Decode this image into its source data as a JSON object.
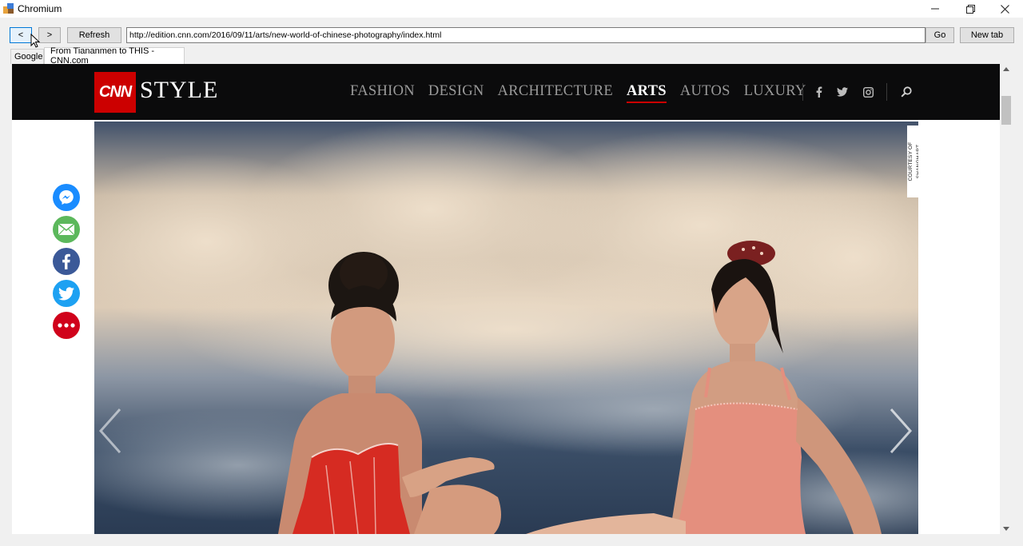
{
  "window": {
    "title": "Chromium",
    "controls": {
      "minimize": "—",
      "maximize": "❐",
      "close": "✕"
    }
  },
  "toolbar": {
    "back_label": "<",
    "forward_label": ">",
    "refresh_label": "Refresh",
    "url": "http://edition.cnn.com/2016/09/11/arts/new-world-of-chinese-photography/index.html",
    "go_label": "Go",
    "new_tab_label": "New tab"
  },
  "tabs": [
    {
      "label": "Google",
      "active": false
    },
    {
      "label": "From Tiananmen to THIS - CNN.com",
      "active": true
    }
  ],
  "page": {
    "logo_text": "CNN",
    "brand_word": "STYLE",
    "nav": [
      {
        "label": "FASHION",
        "active": false
      },
      {
        "label": "DESIGN",
        "active": false
      },
      {
        "label": "ARCHITECTURE",
        "active": false
      },
      {
        "label": "ARTS",
        "active": true
      },
      {
        "label": "AUTOS",
        "active": false
      },
      {
        "label": "LUXURY",
        "active": false
      }
    ],
    "social_icons": [
      "facebook-icon",
      "twitter-icon",
      "instagram-icon"
    ],
    "share_icons": [
      "messenger-icon",
      "email-icon",
      "facebook-icon",
      "twitter-icon",
      "more-icon"
    ],
    "image_credit": "COURTESY OF SHANGHART",
    "colors": {
      "cnn_red": "#cc0000",
      "header_bg": "#0b0b0c",
      "messenger": "#1a8cff",
      "email": "#5cb85c",
      "facebook": "#3b5998",
      "twitter": "#1da1f2",
      "more": "#d0021b"
    }
  }
}
